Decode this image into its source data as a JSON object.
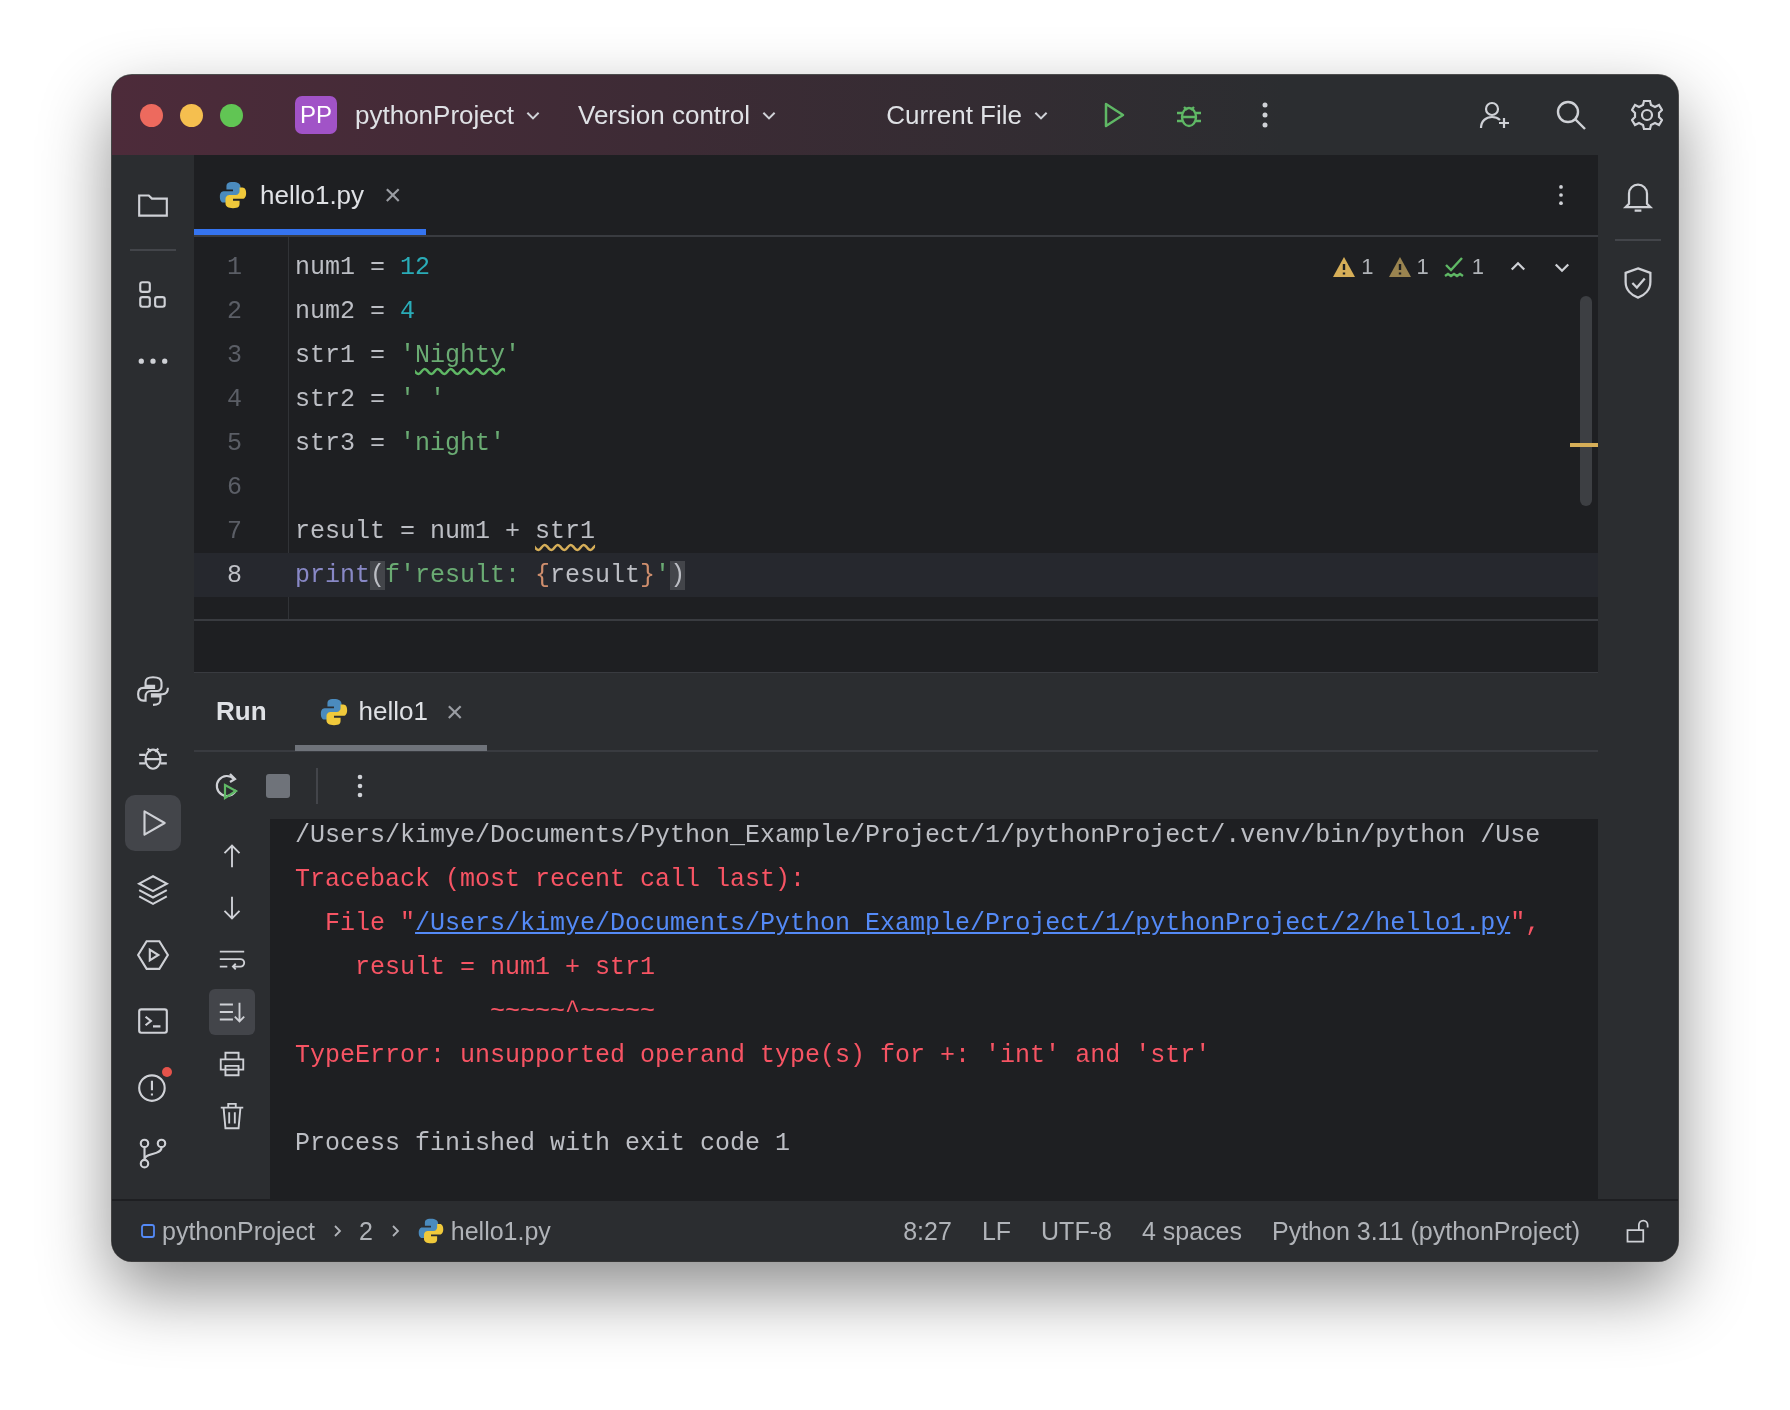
{
  "title_bar": {
    "project_badge": "PP",
    "project": "pythonProject",
    "vcs": "Version control",
    "run_config": "Current File"
  },
  "left_tools": [
    {
      "kind": "folder",
      "selected": false,
      "alert": false
    },
    {
      "kind": "structure",
      "selected": false,
      "alert": false
    },
    {
      "kind": "more",
      "selected": false,
      "alert": false
    },
    {
      "kind": "python",
      "selected": false,
      "alert": false
    },
    {
      "kind": "debug",
      "selected": false,
      "alert": false
    },
    {
      "kind": "run",
      "selected": true,
      "alert": false
    },
    {
      "kind": "layers",
      "selected": false,
      "alert": false
    },
    {
      "kind": "services",
      "selected": false,
      "alert": false
    },
    {
      "kind": "terminal",
      "selected": false,
      "alert": false
    },
    {
      "kind": "problems",
      "selected": false,
      "alert": true
    },
    {
      "kind": "git",
      "selected": false,
      "alert": false
    }
  ],
  "editor_tabs": [
    {
      "label": "hello1.py",
      "selected": true,
      "close": "×"
    }
  ],
  "inspections": [
    {
      "kind": "warning",
      "count": "1"
    },
    {
      "kind": "weak_warning",
      "count": "1"
    },
    {
      "kind": "typo",
      "count": "1"
    }
  ],
  "code_lines": [
    {
      "number": "1",
      "current": false,
      "tokens": [
        {
          "kind": "plain",
          "text": "num1 = "
        },
        {
          "kind": "number",
          "text": "12"
        }
      ]
    },
    {
      "number": "2",
      "current": false,
      "tokens": [
        {
          "kind": "plain",
          "text": "num2 = "
        },
        {
          "kind": "number",
          "text": "4"
        }
      ]
    },
    {
      "number": "3",
      "current": false,
      "tokens": [
        {
          "kind": "plain",
          "text": "str1 = "
        },
        {
          "kind": "string",
          "text": "'"
        },
        {
          "kind": "typo",
          "text": "Nighty"
        },
        {
          "kind": "string",
          "text": "'"
        }
      ]
    },
    {
      "number": "4",
      "current": false,
      "tokens": [
        {
          "kind": "plain",
          "text": "str2 = "
        },
        {
          "kind": "string",
          "text": "' '"
        }
      ]
    },
    {
      "number": "5",
      "current": false,
      "tokens": [
        {
          "kind": "plain",
          "text": "str3 = "
        },
        {
          "kind": "string",
          "text": "'night'"
        }
      ]
    },
    {
      "number": "6",
      "current": false
    },
    {
      "number": "7",
      "current": false,
      "tokens": [
        {
          "kind": "plain",
          "text": "result = num1 + "
        },
        {
          "kind": "warning",
          "text": "str1"
        }
      ]
    },
    {
      "number": "8",
      "current": true,
      "tokens": [
        {
          "kind": "builtin",
          "text": "print"
        },
        {
          "kind": "match",
          "text": "("
        },
        {
          "kind": "string",
          "text": "f'result: "
        },
        {
          "kind": "brace",
          "text": "{"
        },
        {
          "kind": "plain",
          "text": "result"
        },
        {
          "kind": "brace",
          "text": "}"
        },
        {
          "kind": "string",
          "text": "'"
        },
        {
          "kind": "match",
          "text": ")"
        }
      ]
    }
  ],
  "run_panel": {
    "title": "Run",
    "tabs": [
      {
        "label": "hello1",
        "selected": true,
        "close": "×"
      }
    ]
  },
  "console_tools": [
    {
      "kind": "up",
      "selected": false
    },
    {
      "kind": "down",
      "selected": false
    },
    {
      "kind": "wrap",
      "selected": false
    },
    {
      "kind": "scroll_end",
      "selected": true
    },
    {
      "kind": "print",
      "selected": false
    },
    {
      "kind": "trash",
      "selected": false
    }
  ],
  "console_lines": [
    {
      "kind": "plain",
      "tokens": [
        {
          "kind": "text",
          "text": "/Users/kimye/Documents/Python_Example/Project/1/pythonProject/.venv/bin/python /Use"
        }
      ]
    },
    {
      "kind": "error",
      "tokens": [
        {
          "kind": "text",
          "text": "Traceback (most recent call last):"
        }
      ]
    },
    {
      "kind": "error",
      "tokens": [
        {
          "kind": "text",
          "text": "  File \""
        },
        {
          "kind": "link",
          "text": "/Users/kimye/Documents/Python_Example/Project/1/pythonProject/2/hello1.py"
        },
        {
          "kind": "text",
          "text": "\","
        }
      ]
    },
    {
      "kind": "error",
      "tokens": [
        {
          "kind": "text",
          "text": "    result = num1 + str1"
        }
      ]
    },
    {
      "kind": "error",
      "tokens": [
        {
          "kind": "text",
          "text": "             ~~~~~^~~~~~"
        }
      ]
    },
    {
      "kind": "error",
      "tokens": [
        {
          "kind": "text",
          "text": "TypeError: unsupported operand type(s) for +: 'int' and 'str'"
        }
      ]
    },
    {
      "kind": "plain"
    },
    {
      "kind": "plain",
      "tokens": [
        {
          "kind": "text",
          "text": "Process finished with exit code 1"
        }
      ]
    }
  ],
  "status_bar": {
    "breadcrumbs": [
      {
        "kind": "project",
        "text": "pythonProject"
      },
      {
        "kind": "folder",
        "text": "2"
      },
      {
        "kind": "python",
        "text": "hello1.py"
      }
    ],
    "items": [
      "8:27",
      "LF",
      "UTF-8",
      "4 spaces",
      "Python 3.11 (pythonProject)"
    ]
  }
}
